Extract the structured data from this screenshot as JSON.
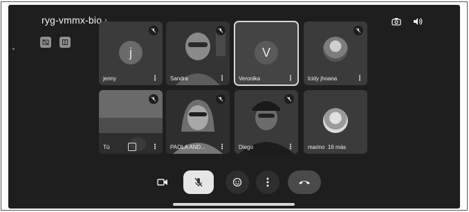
{
  "meeting": {
    "title": "ryg-vmmx-bio",
    "title_chevron": "›"
  },
  "icons": {
    "top_left": [
      "captions-off-icon",
      "layout-icon"
    ],
    "top_right": [
      "camera-switch-icon",
      "speaker-icon"
    ]
  },
  "participants": [
    {
      "name": "jenny",
      "avatar": "j",
      "muted": true,
      "type": "letter"
    },
    {
      "name": "Sandra",
      "muted": true,
      "type": "video"
    },
    {
      "name": "Veronika",
      "avatar": "V",
      "muted": false,
      "type": "letter",
      "selected": true
    },
    {
      "name": "lcidy jhoana",
      "muted": true,
      "type": "photo"
    },
    {
      "name": "Tú",
      "muted": true,
      "type": "video-self"
    },
    {
      "name": "PAOLA AND...",
      "muted": true,
      "type": "video"
    },
    {
      "name": "Diego",
      "muted": true,
      "type": "video"
    },
    {
      "name": "marino",
      "type": "overflow"
    }
  ],
  "overflow_label": "16 más",
  "kebab": "⋮",
  "controls": [
    "video-camera-icon",
    "mic-off-icon",
    "emoji-icon",
    "more-icon",
    "hang-up-icon"
  ]
}
